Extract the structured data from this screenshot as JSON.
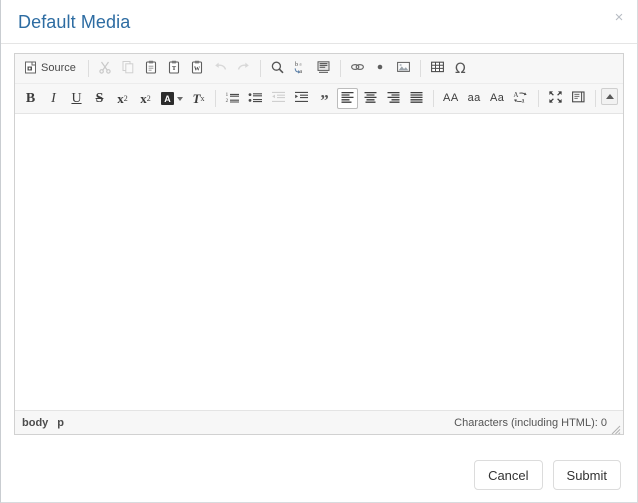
{
  "dialog": {
    "title": "Default Media",
    "close_label": "×"
  },
  "editor": {
    "toolbar_row1": [
      {
        "name": "source-button",
        "label": "Source",
        "icon": "source-icon",
        "type": "text",
        "state": "normal"
      },
      {
        "name": "cut-button",
        "label": "Cut",
        "icon": "scissors-icon",
        "type": "icon",
        "state": "disabled"
      },
      {
        "name": "copy-button",
        "label": "Copy",
        "icon": "copy-icon",
        "type": "icon",
        "state": "disabled"
      },
      {
        "name": "paste-button",
        "label": "Paste",
        "icon": "clipboard-icon",
        "type": "icon",
        "state": "normal"
      },
      {
        "name": "paste-as-text-button",
        "label": "Paste as plain text",
        "icon": "clipboard-text-icon",
        "type": "icon",
        "state": "normal"
      },
      {
        "name": "paste-from-word-button",
        "label": "Paste from Word",
        "icon": "clipboard-word-icon",
        "type": "icon",
        "state": "normal"
      },
      {
        "name": "undo-button",
        "label": "Undo",
        "icon": "undo-arrow-icon",
        "type": "icon",
        "state": "disabled"
      },
      {
        "name": "redo-button",
        "label": "Redo",
        "icon": "redo-arrow-icon",
        "type": "icon",
        "state": "disabled"
      },
      {
        "name": "find-button",
        "label": "Find",
        "icon": "magnifier-icon",
        "type": "icon",
        "state": "normal"
      },
      {
        "name": "replace-button",
        "label": "Replace",
        "icon": "replace-icon",
        "type": "icon",
        "state": "normal"
      },
      {
        "name": "select-all-button",
        "label": "Select All",
        "icon": "select-all-icon",
        "type": "icon",
        "state": "normal"
      },
      {
        "name": "link-button",
        "label": "Link",
        "icon": "chain-link-icon",
        "type": "icon",
        "state": "normal"
      },
      {
        "name": "anchor-button",
        "label": "Anchor",
        "icon": "anchor-dot-icon",
        "type": "icon",
        "state": "normal"
      },
      {
        "name": "image-button",
        "label": "Image",
        "icon": "picture-icon",
        "type": "icon",
        "state": "normal"
      },
      {
        "name": "table-button",
        "label": "Table",
        "icon": "table-grid-icon",
        "type": "icon",
        "state": "normal"
      },
      {
        "name": "special-char-button",
        "label": "Ω",
        "icon": "omega-icon",
        "type": "icon",
        "state": "normal"
      }
    ],
    "toolbar_row2": [
      {
        "name": "bold-button",
        "label": "B",
        "icon": "bold-icon",
        "state": "normal"
      },
      {
        "name": "italic-button",
        "label": "I",
        "icon": "italic-icon",
        "state": "normal"
      },
      {
        "name": "underline-button",
        "label": "U",
        "icon": "underline-icon",
        "state": "normal"
      },
      {
        "name": "strikethrough-button",
        "label": "S",
        "icon": "strikethrough-icon",
        "state": "normal"
      },
      {
        "name": "subscript-button",
        "label": "x",
        "sub": "2",
        "icon": "subscript-icon",
        "state": "normal"
      },
      {
        "name": "superscript-button",
        "label": "x",
        "sup": "2",
        "icon": "superscript-icon",
        "state": "normal"
      },
      {
        "name": "text-color-button",
        "label": "A",
        "icon": "text-color-icon",
        "state": "normal"
      },
      {
        "name": "remove-format-button",
        "label": "T",
        "sub": "x",
        "icon": "remove-format-icon",
        "state": "normal"
      },
      {
        "name": "numbered-list-button",
        "label": "Insert/Remove Numbered List",
        "icon": "numbered-list-icon",
        "state": "normal"
      },
      {
        "name": "bulleted-list-button",
        "label": "Insert/Remove Bulleted List",
        "icon": "bulleted-list-icon",
        "state": "normal"
      },
      {
        "name": "outdent-button",
        "label": "Decrease Indent",
        "icon": "outdent-icon",
        "state": "disabled"
      },
      {
        "name": "indent-button",
        "label": "Increase Indent",
        "icon": "indent-icon",
        "state": "normal"
      },
      {
        "name": "blockquote-button",
        "label": "Block Quote",
        "icon": "quote-icon",
        "state": "normal"
      },
      {
        "name": "align-left-button",
        "label": "Align Left",
        "icon": "align-left-icon",
        "state": "active"
      },
      {
        "name": "align-center-button",
        "label": "Center",
        "icon": "align-center-icon",
        "state": "normal"
      },
      {
        "name": "align-right-button",
        "label": "Align Right",
        "icon": "align-right-icon",
        "state": "normal"
      },
      {
        "name": "justify-button",
        "label": "Justify",
        "icon": "align-justify-icon",
        "state": "normal"
      },
      {
        "name": "uppercase-button",
        "label": "AA",
        "icon": "uppercase-icon",
        "state": "normal"
      },
      {
        "name": "lowercase-button",
        "label": "aa",
        "icon": "lowercase-icon",
        "state": "normal"
      },
      {
        "name": "capitalize-button",
        "label": "Aa",
        "icon": "capitalize-icon",
        "state": "normal"
      },
      {
        "name": "change-case-button",
        "label": "Aa",
        "icon": "change-case-icon",
        "state": "normal"
      },
      {
        "name": "maximize-button",
        "label": "Maximize",
        "icon": "maximize-icon",
        "state": "normal"
      },
      {
        "name": "show-blocks-button",
        "label": "Show Blocks",
        "icon": "show-blocks-icon",
        "state": "normal"
      },
      {
        "name": "help-button",
        "label": "?",
        "icon": "question-mark-icon",
        "state": "normal"
      }
    ],
    "collapse_toolbar_label": "Collapse Toolbar",
    "content_value": "",
    "elements_path": [
      "body",
      "p"
    ],
    "char_count": "Characters (including HTML): 0",
    "resize_label": "Resize"
  },
  "footer": {
    "cancel_label": "Cancel",
    "submit_label": "Submit"
  },
  "colors": {
    "title": "#2d6ca2",
    "toolbar_bg": "#f7f7f7",
    "editor_border": "#d1d1d1",
    "text": "#333333"
  }
}
